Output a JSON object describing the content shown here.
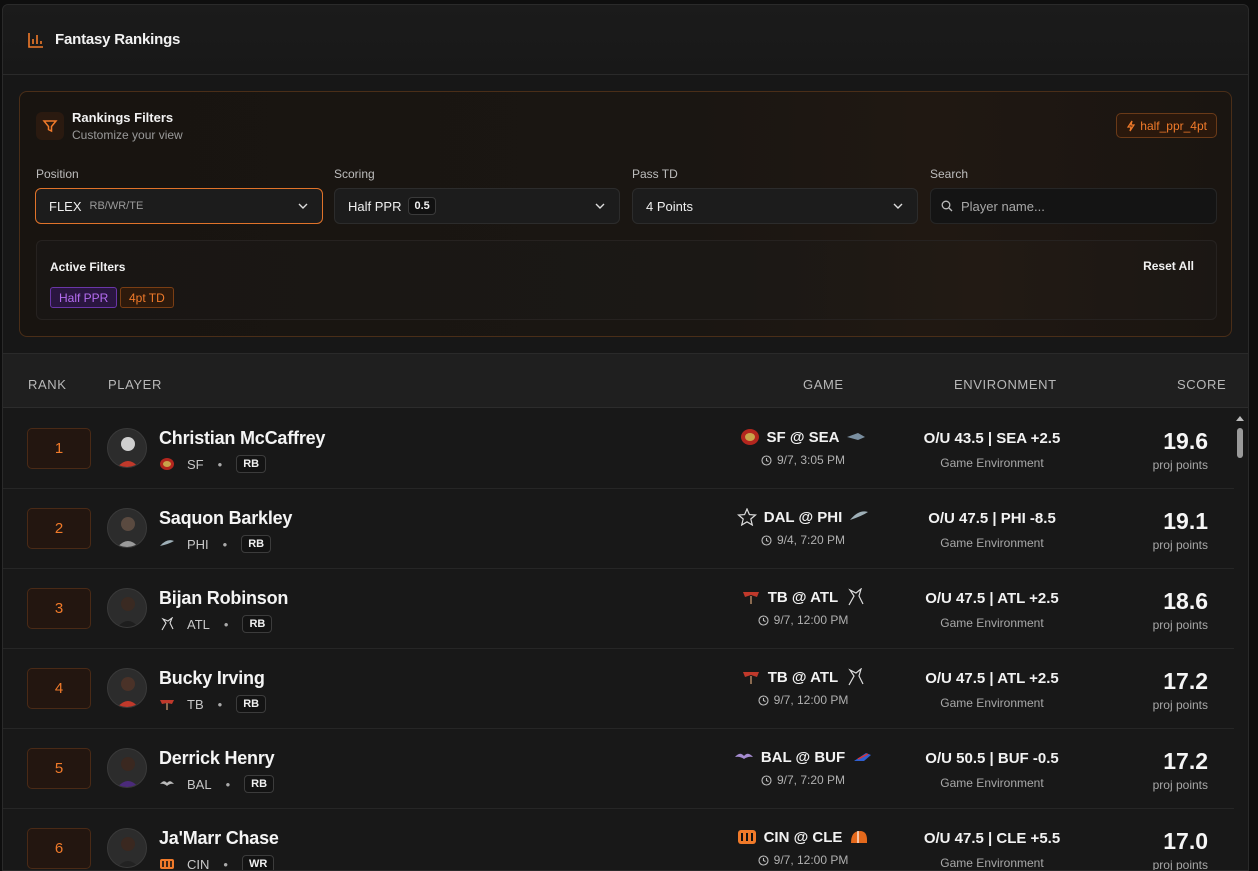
{
  "header": {
    "title": "Fantasy Rankings",
    "icon": "bar-chart-icon"
  },
  "filters": {
    "title": "Rankings Filters",
    "subtitle": "Customize your view",
    "preset_badge": "half_ppr_4pt",
    "position": {
      "label": "Position",
      "value": "FLEX",
      "hint": "RB/WR/TE"
    },
    "scoring": {
      "label": "Scoring",
      "value": "Half PPR",
      "pill": "0.5"
    },
    "pass_td": {
      "label": "Pass TD",
      "value": "4 Points"
    },
    "search": {
      "label": "Search",
      "placeholder": "Player name..."
    },
    "active": {
      "title": "Active Filters",
      "reset_label": "Reset All",
      "chips": [
        "Half PPR",
        "4pt TD"
      ]
    }
  },
  "table": {
    "headers": {
      "rank": "RANK",
      "player": "PLAYER",
      "game": "GAME",
      "environment": "ENVIRONMENT",
      "score": "SCORE"
    },
    "rows": [
      {
        "rank": "1",
        "name": "Christian McCaffrey",
        "team": "SF",
        "position": "RB",
        "game": "SF @ SEA",
        "time": "9/7, 3:05 PM",
        "env": "O/U 43.5 | SEA +2.5",
        "env_sub": "Game Environment",
        "score": "19.6",
        "score_sub": "proj points"
      },
      {
        "rank": "2",
        "name": "Saquon Barkley",
        "team": "PHI",
        "position": "RB",
        "game": "DAL @ PHI",
        "time": "9/4, 7:20 PM",
        "env": "O/U 47.5 | PHI -8.5",
        "env_sub": "Game Environment",
        "score": "19.1",
        "score_sub": "proj points"
      },
      {
        "rank": "3",
        "name": "Bijan Robinson",
        "team": "ATL",
        "position": "RB",
        "game": "TB @ ATL",
        "time": "9/7, 12:00 PM",
        "env": "O/U 47.5 | ATL +2.5",
        "env_sub": "Game Environment",
        "score": "18.6",
        "score_sub": "proj points"
      },
      {
        "rank": "4",
        "name": "Bucky Irving",
        "team": "TB",
        "position": "RB",
        "game": "TB @ ATL",
        "time": "9/7, 12:00 PM",
        "env": "O/U 47.5 | ATL +2.5",
        "env_sub": "Game Environment",
        "score": "17.2",
        "score_sub": "proj points"
      },
      {
        "rank": "5",
        "name": "Derrick Henry",
        "team": "BAL",
        "position": "RB",
        "game": "BAL @ BUF",
        "time": "9/7, 7:20 PM",
        "env": "O/U 50.5 | BUF -0.5",
        "env_sub": "Game Environment",
        "score": "17.2",
        "score_sub": "proj points"
      },
      {
        "rank": "6",
        "name": "Ja'Marr Chase",
        "team": "CIN",
        "position": "WR",
        "game": "CIN @ CLE",
        "time": "9/7, 12:00 PM",
        "env": "O/U 47.5 | CLE +5.5",
        "env_sub": "Game Environment",
        "score": "17.0",
        "score_sub": "proj points"
      }
    ]
  },
  "colors": {
    "accent": "#f07a2a",
    "purple_chip": "#b46cf0",
    "background": "#171717"
  }
}
